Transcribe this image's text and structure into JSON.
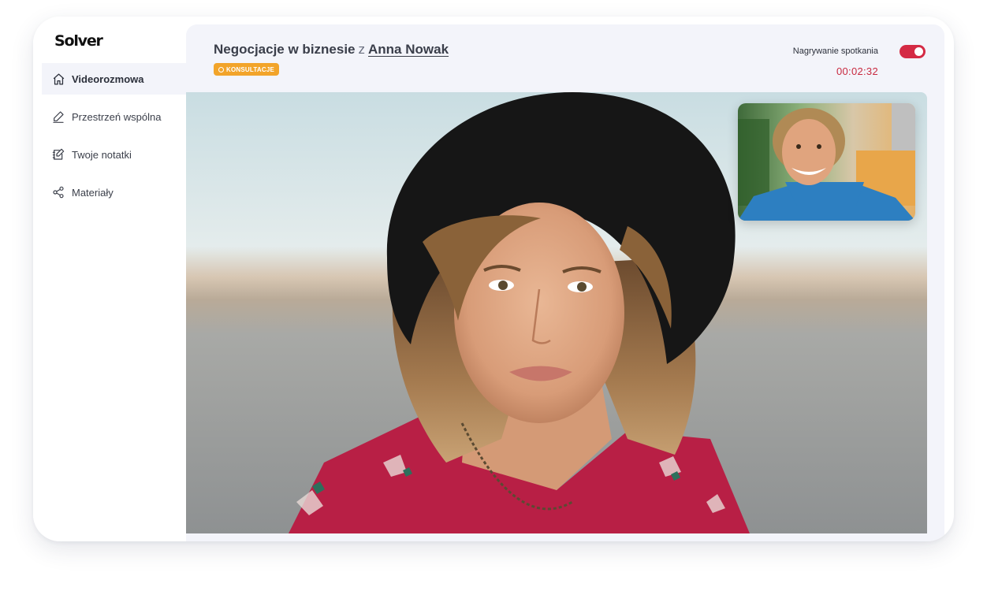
{
  "app": {
    "logo_text": "Solver"
  },
  "sidebar": {
    "items": [
      {
        "label": "Videorozmowa",
        "icon": "home-icon",
        "active": true
      },
      {
        "label": "Przestrzeń wspólna",
        "icon": "pencil-icon",
        "active": false
      },
      {
        "label": "Twoje notatki",
        "icon": "note-edit-icon",
        "active": false
      },
      {
        "label": "Materiały",
        "icon": "share-icon",
        "active": false
      }
    ]
  },
  "header": {
    "title": "Negocjacje w biznesie",
    "separator": "z",
    "participant_name": "Anna Nowak",
    "badge_label": "KONSULTACJE",
    "recording_label": "Nagrywanie spotkania",
    "recording_enabled": true,
    "timer": "00:02:32"
  },
  "colors": {
    "accent_red": "#d42a44",
    "badge_orange": "#f2a42a",
    "timer_red": "#c8293f",
    "main_bg": "#f3f4fa"
  }
}
